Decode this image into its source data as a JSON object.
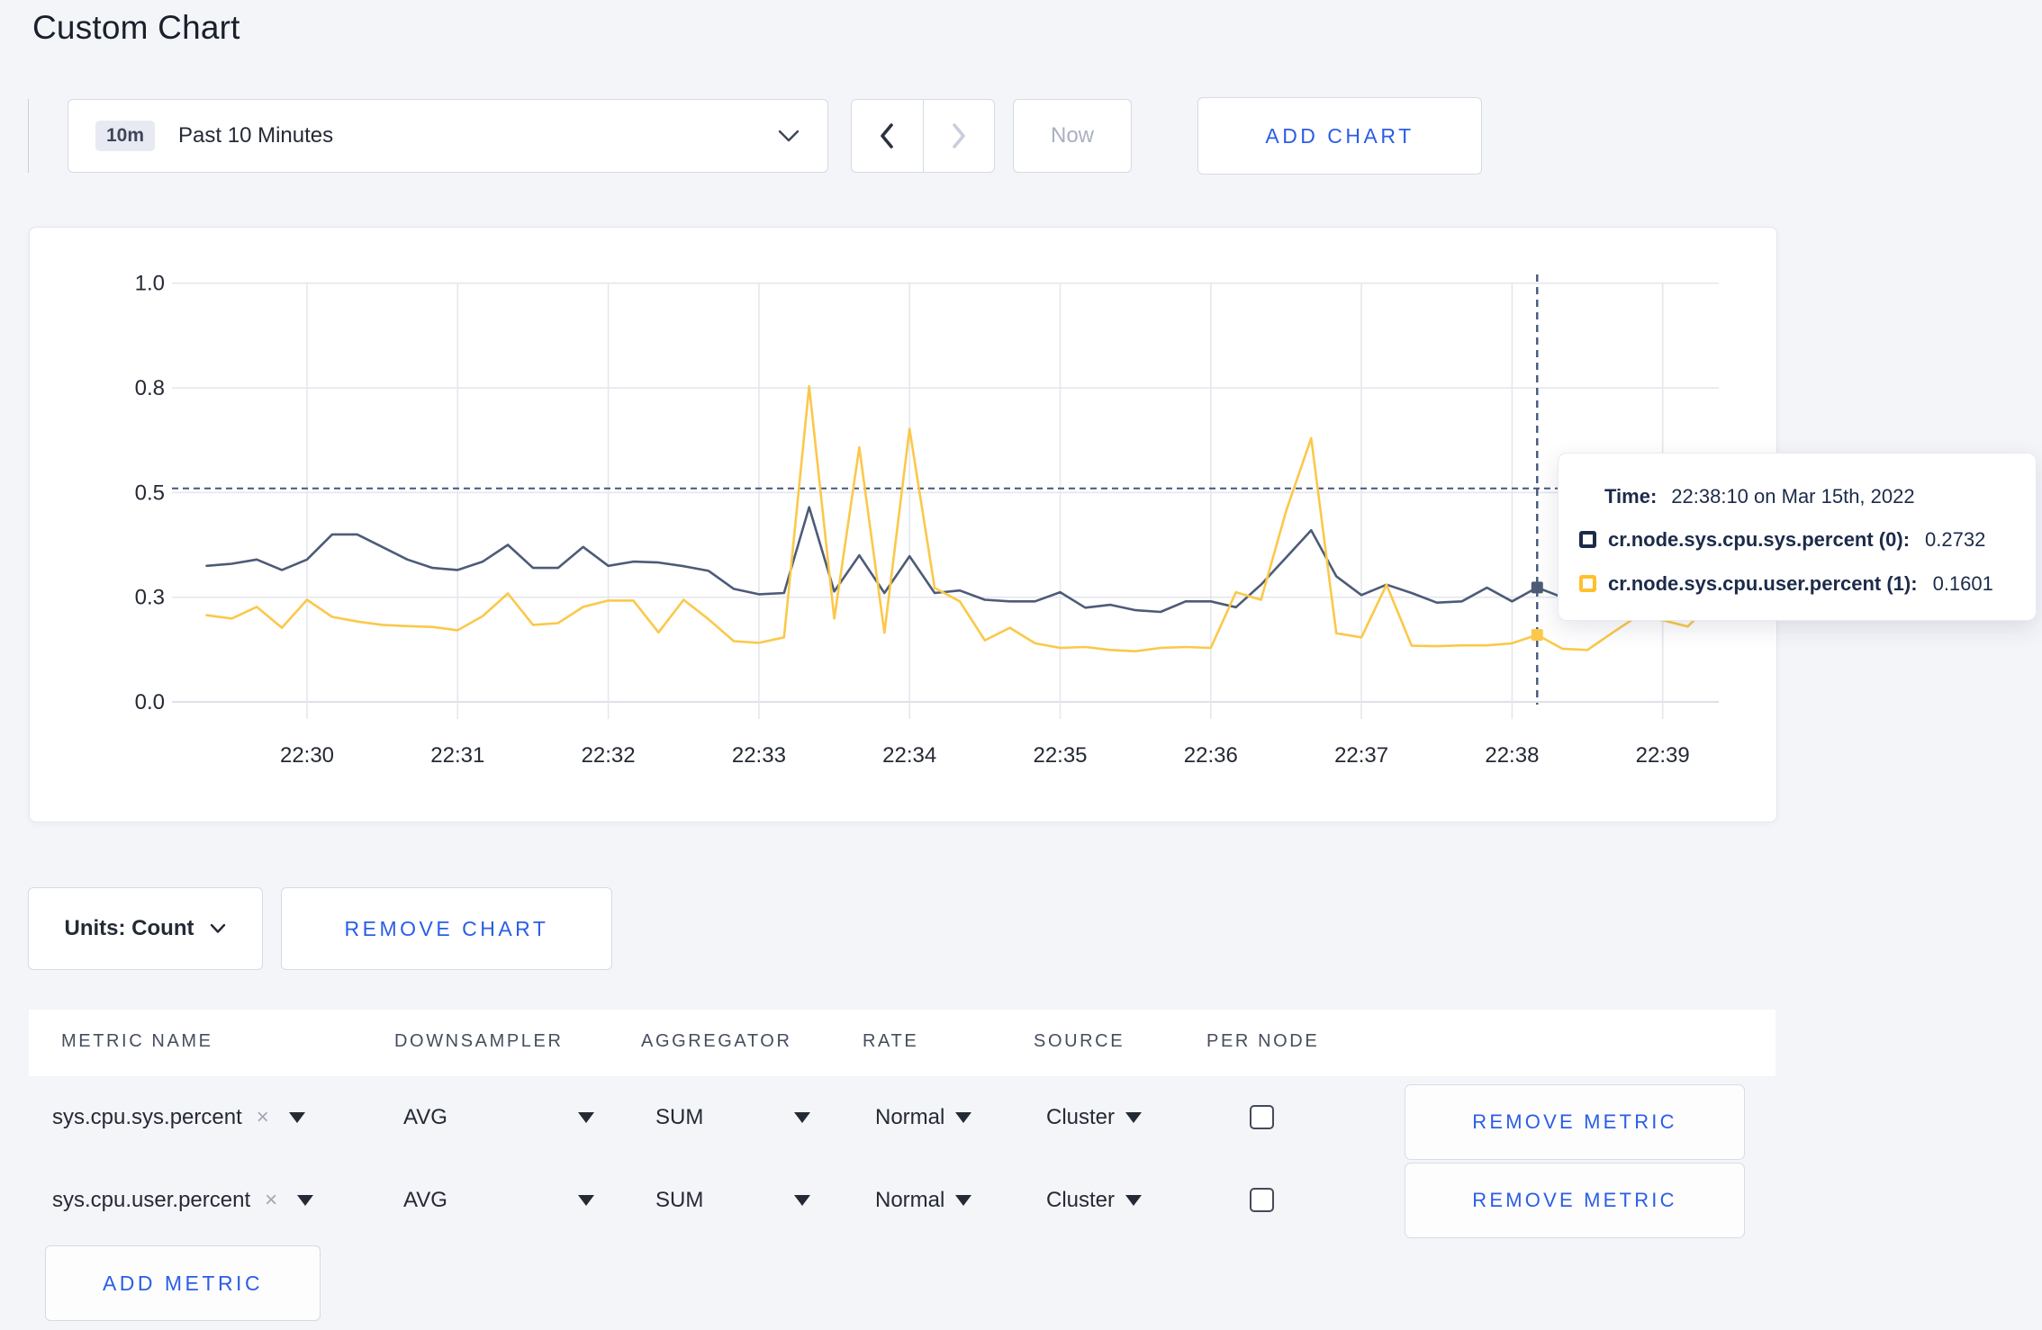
{
  "page": {
    "title": "Custom Chart"
  },
  "toolbar": {
    "range_badge": "10m",
    "range_label": "Past 10 Minutes",
    "now_label": "Now",
    "add_chart_label": "ADD CHART"
  },
  "chart_footer": {
    "units_label": "Units: Count",
    "remove_chart_label": "REMOVE CHART"
  },
  "tooltip": {
    "time_label": "Time:",
    "time_value": "22:38:10 on Mar 15th, 2022",
    "rows": [
      {
        "label": "cr.node.sys.cpu.sys.percent (0):",
        "value": "0.2732",
        "swatch_color": "#1C2B4A"
      },
      {
        "label": "cr.node.sys.cpu.user.percent (1):",
        "value": "0.1601",
        "swatch_color": "#FFC02B"
      }
    ]
  },
  "chart_data": {
    "type": "line",
    "title": "",
    "xlabel": "",
    "ylabel": "",
    "ylim": [
      0,
      1
    ],
    "grid": true,
    "legend_position": "none",
    "y_ticks": [
      {
        "value": 0.0,
        "label": "0.0"
      },
      {
        "value": 0.25,
        "label": "0.3"
      },
      {
        "value": 0.5,
        "label": "0.5"
      },
      {
        "value": 0.75,
        "label": "0.8"
      },
      {
        "value": 1.0,
        "label": "1.0"
      }
    ],
    "x_ticks": [
      "22:30",
      "22:31",
      "22:32",
      "22:33",
      "22:34",
      "22:35",
      "22:36",
      "22:37",
      "22:38",
      "22:39"
    ],
    "interval_seconds": 10,
    "start_offset_seconds": -40,
    "x": [
      "22:29:20",
      "22:29:30",
      "22:29:40",
      "22:29:50",
      "22:30:00",
      "22:30:10",
      "22:30:20",
      "22:30:30",
      "22:30:40",
      "22:30:50",
      "22:31:00",
      "22:31:10",
      "22:31:20",
      "22:31:30",
      "22:31:40",
      "22:31:50",
      "22:32:00",
      "22:32:10",
      "22:32:20",
      "22:32:30",
      "22:32:40",
      "22:32:50",
      "22:33:00",
      "22:33:10",
      "22:33:20",
      "22:33:30",
      "22:33:40",
      "22:33:50",
      "22:34:00",
      "22:34:10",
      "22:34:20",
      "22:34:30",
      "22:34:40",
      "22:34:50",
      "22:35:00",
      "22:35:10",
      "22:35:20",
      "22:35:30",
      "22:35:40",
      "22:35:50",
      "22:36:00",
      "22:36:10",
      "22:36:20",
      "22:36:30",
      "22:36:40",
      "22:36:50",
      "22:37:00",
      "22:37:10",
      "22:37:20",
      "22:37:30",
      "22:37:40",
      "22:37:50",
      "22:38:00",
      "22:38:10",
      "22:38:20",
      "22:38:30",
      "22:38:40",
      "22:38:50",
      "22:39:00",
      "22:39:10",
      "22:39:20"
    ],
    "series": [
      {
        "name": "cr.node.sys.cpu.sys.percent",
        "color": "#4D5B77",
        "values": [
          0.325,
          0.33,
          0.34,
          0.315,
          0.34,
          0.4,
          0.4,
          0.37,
          0.34,
          0.32,
          0.315,
          0.335,
          0.375,
          0.32,
          0.32,
          0.37,
          0.325,
          0.335,
          0.333,
          0.324,
          0.313,
          0.27,
          0.257,
          0.26,
          0.465,
          0.264,
          0.35,
          0.26,
          0.348,
          0.26,
          0.266,
          0.244,
          0.24,
          0.24,
          0.262,
          0.225,
          0.232,
          0.219,
          0.215,
          0.24,
          0.24,
          0.226,
          0.28,
          0.345,
          0.41,
          0.3,
          0.255,
          0.28,
          0.26,
          0.237,
          0.24,
          0.273,
          0.24,
          0.2732,
          0.25,
          0.26,
          0.27,
          0.275,
          0.27,
          0.275,
          0.28
        ]
      },
      {
        "name": "cr.node.sys.cpu.user.percent",
        "color": "#FBC84A",
        "values": [
          0.207,
          0.199,
          0.227,
          0.177,
          0.244,
          0.203,
          0.192,
          0.184,
          0.181,
          0.179,
          0.171,
          0.205,
          0.259,
          0.184,
          0.188,
          0.227,
          0.242,
          0.242,
          0.166,
          0.244,
          0.197,
          0.145,
          0.141,
          0.154,
          0.754,
          0.199,
          0.608,
          0.165,
          0.652,
          0.272,
          0.24,
          0.147,
          0.177,
          0.14,
          0.129,
          0.131,
          0.124,
          0.121,
          0.129,
          0.131,
          0.129,
          0.262,
          0.244,
          0.456,
          0.63,
          0.164,
          0.154,
          0.28,
          0.134,
          0.133,
          0.135,
          0.135,
          0.14,
          0.1601,
          0.127,
          0.124,
          0.165,
          0.205,
          0.195,
          0.18,
          0.24
        ]
      }
    ],
    "crosshair": {
      "time": "22:38:10",
      "seconds_from_first_tick": 490,
      "y_value": 0.51
    },
    "hover_points": [
      {
        "series": 0,
        "time": "22:38:10",
        "value": 0.2732
      },
      {
        "series": 1,
        "time": "22:38:10",
        "value": 0.1601
      }
    ]
  },
  "metrics_table": {
    "headers": [
      "METRIC NAME",
      "DOWNSAMPLER",
      "AGGREGATOR",
      "RATE",
      "SOURCE",
      "PER NODE"
    ],
    "remove_metric_label": "REMOVE METRIC",
    "add_metric_label": "ADD METRIC",
    "rows": [
      {
        "metric": "sys.cpu.sys.percent",
        "remove_x": "×",
        "downsampler": "AVG",
        "aggregator": "SUM",
        "rate": "Normal",
        "source": "Cluster",
        "per_node_checked": false
      },
      {
        "metric": "sys.cpu.user.percent",
        "remove_x": "×",
        "downsampler": "AVG",
        "aggregator": "SUM",
        "rate": "Normal",
        "source": "Cluster",
        "per_node_checked": false
      }
    ]
  },
  "colors": {
    "accent_blue": "#2B5DE5",
    "crosshair": "#42587C",
    "gridline": "#E5E7ED",
    "axis_text": "#242A35"
  }
}
